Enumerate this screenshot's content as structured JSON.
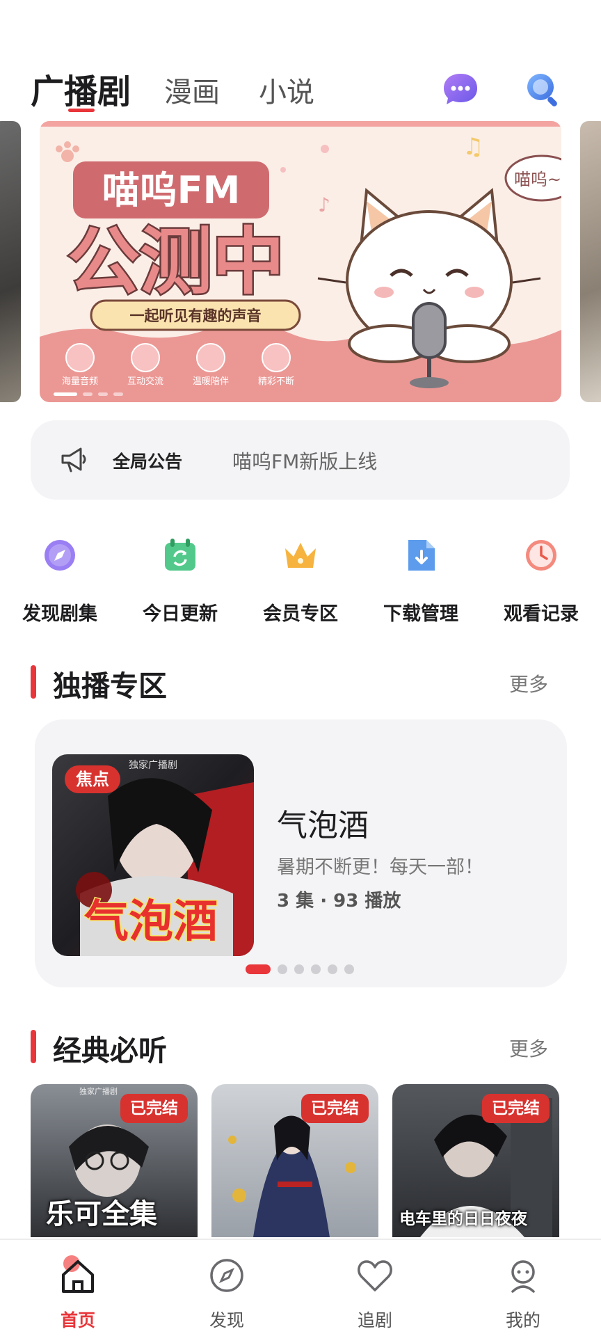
{
  "top_tabs": {
    "items": [
      {
        "label": "广播剧",
        "active": true
      },
      {
        "label": "漫画",
        "active": false
      },
      {
        "label": "小说",
        "active": false
      }
    ],
    "message_icon": "chat-bubble-icon",
    "search_icon": "search-icon"
  },
  "banner": {
    "brand": "喵呜FM",
    "headline": "公测中",
    "slogan": "一起听见有趣的声音",
    "bubble": "喵呜~",
    "features": [
      "海量音频",
      "互动交流",
      "温暖陪伴",
      "精彩不断"
    ],
    "active_indicator": 1,
    "indicator_count": 4
  },
  "notice": {
    "label": "全局公告",
    "text": "喵呜FM新版上线",
    "icon": "megaphone-icon"
  },
  "quick_entries": [
    {
      "label": "发现剧集",
      "icon": "compass-icon",
      "color": "#8b6cf0"
    },
    {
      "label": "今日更新",
      "icon": "calendar-refresh-icon",
      "color": "#3cc47c"
    },
    {
      "label": "会员专区",
      "icon": "crown-icon",
      "color": "#f5a623"
    },
    {
      "label": "下载管理",
      "icon": "download-file-icon",
      "color": "#4a90e2"
    },
    {
      "label": "观看记录",
      "icon": "clock-icon",
      "color": "#f07a6e"
    }
  ],
  "exclusive": {
    "title": "独播专区",
    "more": "更多",
    "item": {
      "badge": "焦点",
      "cover_tag": "独家广播剧",
      "cover_title": "气泡酒",
      "title": "气泡酒",
      "subtitle": "暑期不断更！每天一部！",
      "meta": "3 集 · 93 播放"
    },
    "page_count": 6,
    "active_page": 1
  },
  "classic": {
    "title": "经典必听",
    "more": "更多",
    "items": [
      {
        "badge": "已完结",
        "cover_tag": "独家广播剧",
        "caption": "乐可全集"
      },
      {
        "badge": "已完结",
        "caption": ""
      },
      {
        "badge": "已完结",
        "caption": "电车里的日日夜夜"
      }
    ]
  },
  "bottom_nav": [
    {
      "label": "首页",
      "icon": "home-icon",
      "active": true
    },
    {
      "label": "发现",
      "icon": "compass-icon",
      "active": false
    },
    {
      "label": "追剧",
      "icon": "heart-icon",
      "active": false
    },
    {
      "label": "我的",
      "icon": "profile-icon",
      "active": false
    }
  ],
  "colors": {
    "accent": "#e8363b",
    "banner_pink": "#e98a8a",
    "card_bg": "#f4f4f6"
  }
}
